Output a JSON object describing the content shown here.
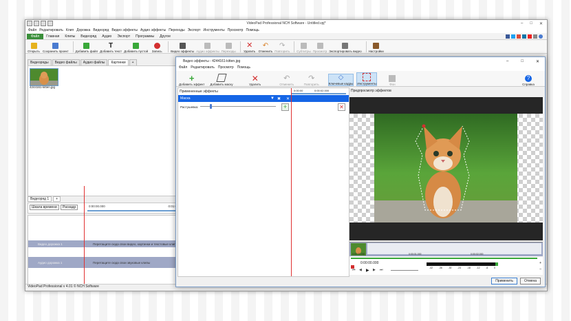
{
  "main": {
    "title": "VideoPad Professional NCH Software - Untitled.vpj*",
    "menu": [
      "Файл",
      "Редактировать",
      "Клип",
      "Дорожка",
      "Видеоряд",
      "Аудио эффекты",
      "Переходы",
      "Экспорт",
      "Инструменты",
      "Просмотр",
      "Помощь"
    ],
    "menu_video_effects": "Видео эффекты",
    "ribbon_tabs": {
      "file": "Файл",
      "items": [
        "Главная",
        "Клипы",
        "Видеоряд",
        "Аудио",
        "Экспорт",
        "Программы",
        "Другое"
      ]
    },
    "toolbar": [
      {
        "label": "Открыть",
        "color": "#e6b21e"
      },
      {
        "label": "Сохранить проект",
        "color": "#4a7bd0"
      },
      {
        "label": "Добавить файл",
        "color": "#39a839"
      },
      {
        "label": "Добавить текст",
        "color": "#333333"
      },
      {
        "label": "Добавить пустой",
        "color": "#39a839"
      },
      {
        "label": "Запись",
        "color": "#d32f2f"
      }
    ],
    "toolbar2": [
      {
        "label": "Видео эффекты",
        "disabled": false
      },
      {
        "label": "Аудио эффекты",
        "disabled": true
      },
      {
        "label": "Переходы",
        "disabled": true
      }
    ],
    "toolbar3": [
      {
        "label": "Удалить",
        "disabled": false
      },
      {
        "label": "Отменить",
        "disabled": false
      },
      {
        "label": "Повторить",
        "disabled": true
      }
    ],
    "toolbar4": [
      {
        "label": "Субтитры",
        "disabled": true
      },
      {
        "label": "Просмотр",
        "disabled": true
      },
      {
        "label": "Экспортировать видео",
        "disabled": false
      },
      {
        "label": "Настройки",
        "disabled": false
      }
    ],
    "bin_tabs": [
      "Видеоряды",
      "Видео файлы",
      "Аудио файлы",
      "Картинки",
      "+"
    ],
    "active_bin_tab": "Картинки",
    "bin_item": "4244161-kitten.jpg",
    "sequence_tab": "Видеоряд 1",
    "timeline_scale": "Шкала времени",
    "storyboard": "Раскадр",
    "ruler_start": "0:00:00.000",
    "ruler_mark": "0:01:0",
    "video_track": "Видео дорожка 1",
    "video_track_hint": "Перетащите сюда свои видео, картинки и текстовые клип",
    "audio_track": "Аудио дорожка 1",
    "audio_track_hint": "Перетащите сюда свои звуковые клипы",
    "status": "VideoPad Professional v 4.01 © NCH Software"
  },
  "dialog": {
    "title": "Видео эффекты - 4244161-kitten.jpg",
    "menu": [
      "Файл",
      "Редактировать",
      "Просмотр",
      "Помощь"
    ],
    "tools": [
      {
        "label": "Добавить эффект",
        "disabled": false
      },
      {
        "label": "Добавить маску",
        "disabled": false
      },
      {
        "label": "Удалить",
        "disabled": false
      },
      {
        "label": "Отменить",
        "disabled": true
      },
      {
        "label": "Повторить",
        "disabled": true
      },
      {
        "label": "Ключевые кадры",
        "disabled": false
      },
      {
        "label": "Инструменты",
        "disabled": false
      },
      {
        "label": "Фон",
        "disabled": true
      },
      {
        "label": "Справка",
        "disabled": false
      }
    ],
    "applied_effects": "Примененные эффекты",
    "mini_time_a": "0:00:00",
    "mini_time_b": "0:00:02.000",
    "mask_label": "Маска",
    "feather_label": "Растушевка:",
    "preview_label": "Предпросмотр эффектов",
    "strip_time_a": "0:00:00.000",
    "strip_time_b": "0:00:01.000",
    "strip_time_c": "0:00:02.000",
    "current_time": "0:00:00.000",
    "meter_labels": [
      "-42",
      "-36",
      "-30",
      "-24",
      "-18",
      "-12",
      "-6",
      "0"
    ],
    "apply": "Применить",
    "cancel": "Отмена"
  },
  "colors": {
    "accent_blue": "#1565e6",
    "file_green": "#3a8f3a",
    "playhead_red": "#e03030",
    "track_lilac": "#9fa8c6"
  }
}
